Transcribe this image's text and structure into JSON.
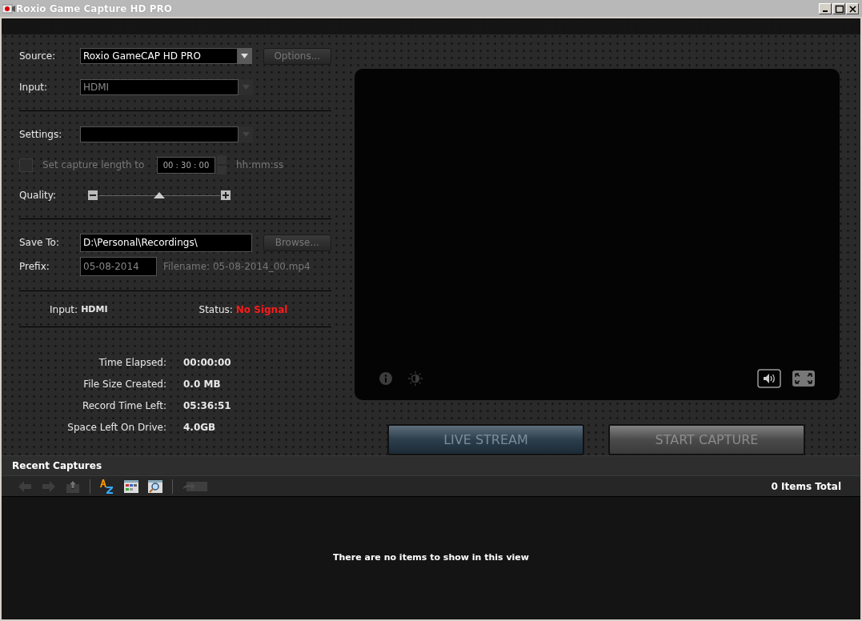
{
  "window": {
    "title": "Roxio Game Capture HD PRO"
  },
  "source": {
    "label": "Source:",
    "value": "Roxio GameCAP HD PRO",
    "disabled": false
  },
  "options_button": {
    "label": "Options...",
    "disabled": true
  },
  "input": {
    "label": "Input:",
    "value": "HDMI",
    "disabled": true
  },
  "settings": {
    "label": "Settings:",
    "disabled": true
  },
  "capture_length": {
    "label": "Set capture length to",
    "checked": false,
    "disabled": true,
    "value": "00 : 30 : 00",
    "format": "hh:mm:ss"
  },
  "quality": {
    "label": "Quality:",
    "level": 0.5
  },
  "save_to": {
    "label": "Save To:",
    "value": "D:\\Personal\\Recordings\\"
  },
  "browse_button": {
    "label": "Browse...",
    "disabled": true
  },
  "prefix": {
    "label": "Prefix:",
    "value": "05-08-2014",
    "filename": "Filename: 05-08-2014_00.mp4"
  },
  "signal": {
    "input_label": "Input:",
    "input_value": "HDMI",
    "status_label": "Status:",
    "status_value": "No Signal"
  },
  "stats": [
    {
      "label": "Time Elapsed:",
      "value": "00:00:00"
    },
    {
      "label": "File Size Created:",
      "value": "0.0 MB"
    },
    {
      "label": "Record Time Left:",
      "value": "05:36:51"
    },
    {
      "label": "Space Left On Drive:",
      "value": "4.0GB"
    }
  ],
  "buttons": [
    {
      "label": "LIVE STREAM",
      "kind": "stream"
    },
    {
      "label": "START CAPTURE",
      "kind": "capture"
    }
  ],
  "recent": {
    "title": "Recent Captures",
    "count": "0 Items Total",
    "empty_text": "There are no items to show in this view",
    "toolbar": [
      [
        {
          "kind": "back",
          "disabled": true
        },
        {
          "kind": "forward",
          "disabled": true
        },
        {
          "kind": "export",
          "disabled": true
        }
      ],
      [
        {
          "kind": "sort",
          "disabled": false
        },
        {
          "kind": "view",
          "disabled": false
        },
        {
          "kind": "zoom",
          "disabled": false
        }
      ],
      [
        {
          "kind": "film",
          "disabled": true
        }
      ]
    ]
  }
}
